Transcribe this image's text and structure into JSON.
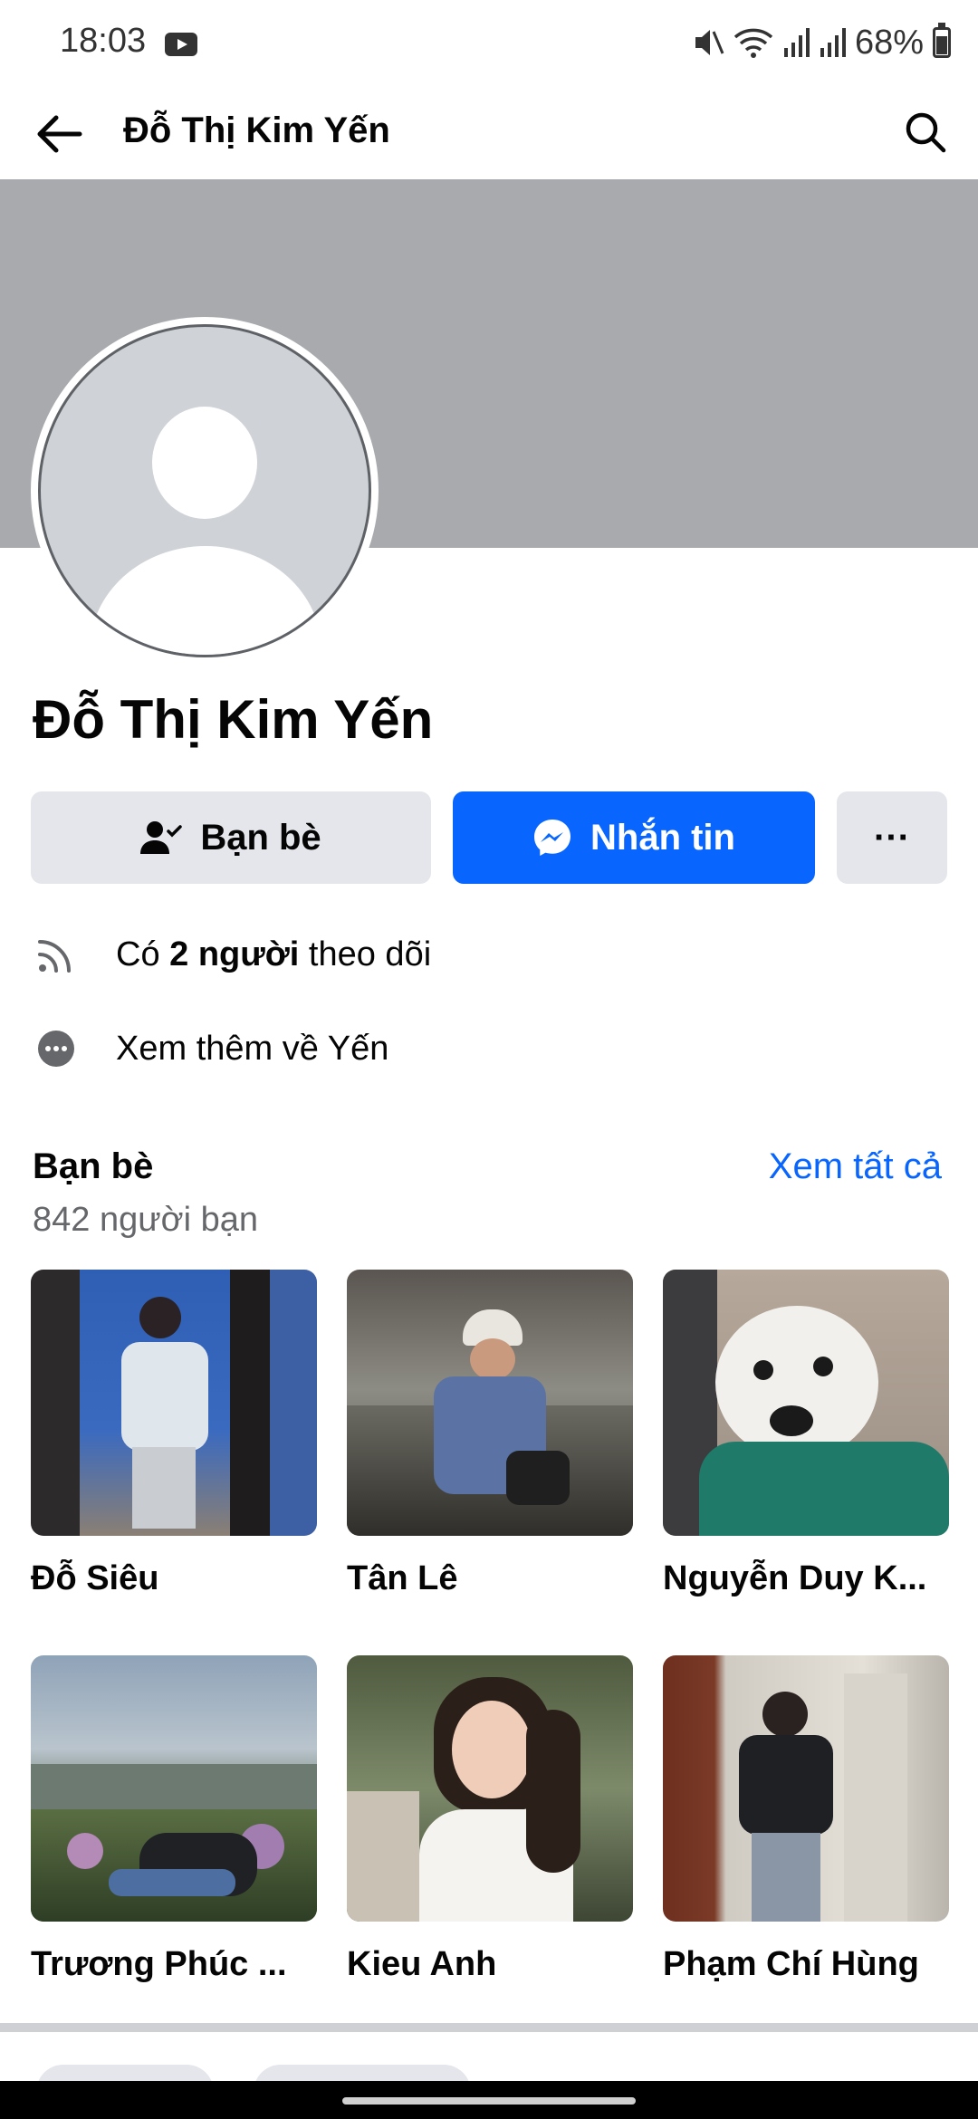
{
  "status_bar": {
    "time": "18:03",
    "battery": "68%"
  },
  "header": {
    "title": "Đỗ Thị Kim Yến"
  },
  "profile": {
    "name": "Đỗ Thị Kim Yến",
    "friends_button": "Bạn bè",
    "message_button": "Nhắn tin",
    "more_button": "···",
    "followers_prefix": "Có ",
    "followers_count": "2 người",
    "followers_suffix": " theo dõi",
    "see_more_about": "Xem thêm về Yến"
  },
  "friends": {
    "title": "Bạn bè",
    "see_all": "Xem tất cả",
    "count": "842 người bạn",
    "items": [
      {
        "name": "Đỗ Siêu"
      },
      {
        "name": "Tân Lê"
      },
      {
        "name": "Nguyễn Duy K..."
      },
      {
        "name": "Trương Phúc ..."
      },
      {
        "name": "Kieu Anh"
      },
      {
        "name": "Phạm Chí Hùng"
      }
    ]
  },
  "colors": {
    "accent": "#0866ff",
    "cover": "#a8aaae",
    "button_gray": "#e4e6eb",
    "secondary_text": "#65676b"
  },
  "icons": [
    "youtube-icon",
    "mute-icon",
    "wifi-icon",
    "signal-icon",
    "battery-icon",
    "back-arrow-icon",
    "search-icon",
    "friend-check-icon",
    "messenger-icon",
    "more-icon",
    "rss-icon",
    "ellipsis-circle-icon"
  ]
}
